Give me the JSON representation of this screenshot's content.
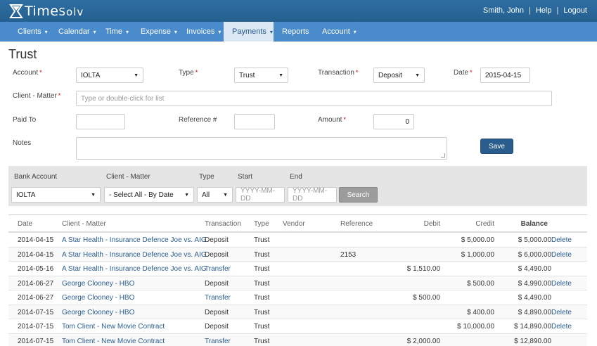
{
  "header": {
    "logo_time": "Time",
    "logo_solv": "Solv",
    "user_name": "Smith, John",
    "help": "Help",
    "logout": "Logout"
  },
  "nav": {
    "items": [
      {
        "label": "Clients",
        "caret": "▾"
      },
      {
        "label": "Calendar",
        "caret": "▾"
      },
      {
        "label": "Time",
        "caret": "▾"
      },
      {
        "label": "Expense",
        "caret": "▾"
      },
      {
        "label": "Invoices",
        "caret": "▾"
      },
      {
        "label": "Payments",
        "caret": "▾",
        "active": true
      },
      {
        "label": "Reports",
        "caret": ""
      },
      {
        "label": "Account",
        "caret": "▾"
      }
    ]
  },
  "page": {
    "title": "Trust"
  },
  "form": {
    "account_label": "Account",
    "account_value": "IOLTA",
    "type_label": "Type",
    "type_value": "Trust",
    "transaction_label": "Transaction",
    "transaction_value": "Deposit",
    "date_label": "Date",
    "date_value": "2015-04-15",
    "client_matter_label": "Client - Matter",
    "client_matter_placeholder": "Type or double-click for list",
    "paid_to_label": "Paid To",
    "paid_to_value": "",
    "reference_label": "Reference #",
    "reference_value": "",
    "amount_label": "Amount",
    "amount_value": "0",
    "notes_label": "Notes",
    "notes_value": "",
    "save_label": "Save",
    "required_mark": "*"
  },
  "filter": {
    "bank_account_label": "Bank Account",
    "bank_account_value": "IOLTA",
    "client_matter_label": "Client - Matter",
    "client_matter_value": "- Select All - By Date",
    "type_label": "Type",
    "type_value": "All",
    "start_label": "Start",
    "start_placeholder": "YYYY-MM-DD",
    "end_label": "End",
    "end_placeholder": "YYYY-MM-DD",
    "search_label": "Search"
  },
  "table": {
    "columns": [
      "Date",
      "Client - Matter",
      "Transaction",
      "Type",
      "Vendor",
      "Reference",
      "Debit",
      "Credit",
      "Balance"
    ],
    "rows": [
      {
        "date": "2014-04-15",
        "client": "A Star Health - Insurance Defence Joe vs. AIG",
        "transaction": "Deposit",
        "type": "Trust",
        "vendor": "",
        "reference": "",
        "debit": "",
        "credit": "$ 5,000.00",
        "balance": "$ 5,000.00",
        "action": "Delete"
      },
      {
        "date": "2014-04-15",
        "client": "A Star Health - Insurance Defence Joe vs. AIG",
        "transaction": "Deposit",
        "type": "Trust",
        "vendor": "",
        "reference": "2153",
        "debit": "",
        "credit": "$ 1,000.00",
        "balance": "$ 6,000.00",
        "action": "Delete"
      },
      {
        "date": "2014-05-16",
        "client": "A Star Health - Insurance Defence Joe vs. AIG",
        "transaction": "Transfer",
        "type": "Trust",
        "vendor": "",
        "reference": "",
        "debit": "$ 1,510.00",
        "credit": "",
        "balance": "$ 4,490.00",
        "action": ""
      },
      {
        "date": "2014-06-27",
        "client": "George Clooney - HBO",
        "transaction": "Deposit",
        "type": "Trust",
        "vendor": "",
        "reference": "",
        "debit": "",
        "credit": "$ 500.00",
        "balance": "$ 4,990.00",
        "action": "Delete"
      },
      {
        "date": "2014-06-27",
        "client": "George Clooney - HBO",
        "transaction": "Transfer",
        "type": "Trust",
        "vendor": "",
        "reference": "",
        "debit": "$ 500.00",
        "credit": "",
        "balance": "$ 4,490.00",
        "action": ""
      },
      {
        "date": "2014-07-15",
        "client": "George Clooney - HBO",
        "transaction": "Deposit",
        "type": "Trust",
        "vendor": "",
        "reference": "",
        "debit": "",
        "credit": "$ 400.00",
        "balance": "$ 4,890.00",
        "action": "Delete"
      },
      {
        "date": "2014-07-15",
        "client": "Tom Client - New Movie Contract",
        "transaction": "Deposit",
        "type": "Trust",
        "vendor": "",
        "reference": "",
        "debit": "",
        "credit": "$ 10,000.00",
        "balance": "$ 14,890.00",
        "action": "Delete"
      },
      {
        "date": "2014-07-15",
        "client": "Tom Client - New Movie Contract",
        "transaction": "Transfer",
        "type": "Trust",
        "vendor": "",
        "reference": "",
        "debit": "$ 2,000.00",
        "credit": "",
        "balance": "$ 12,890.00",
        "action": ""
      }
    ]
  },
  "colors": {
    "header_bg": "#2f6ea3",
    "nav_bg": "#4a8bcb",
    "nav_active_bg": "#dce9f5",
    "link": "#2a5d8e",
    "save_button": "#2a5d8e",
    "search_button": "#9c9c9c",
    "required": "#cc0000"
  }
}
